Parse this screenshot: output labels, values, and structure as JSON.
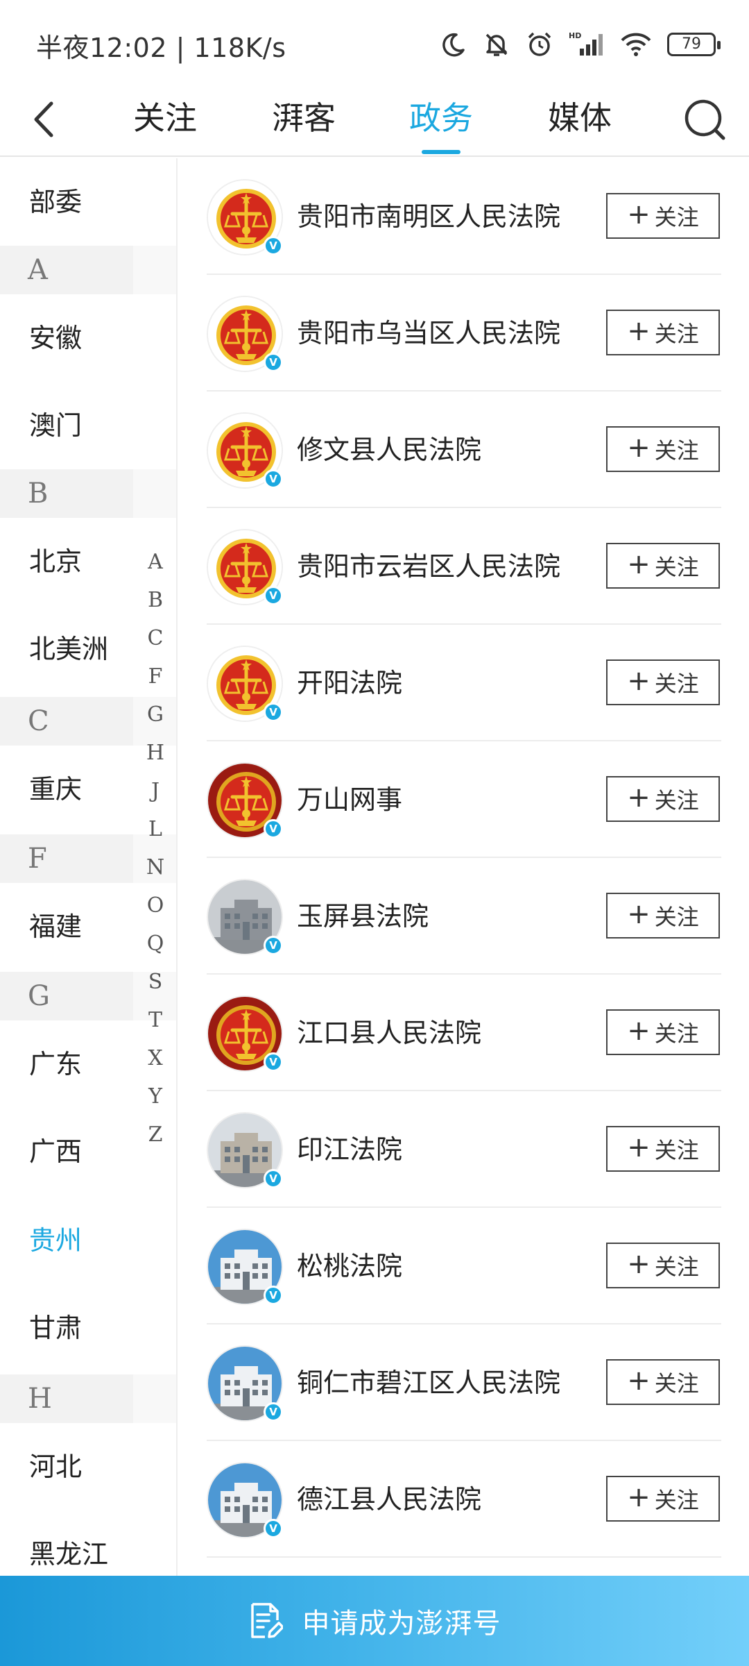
{
  "status_bar": {
    "time_speed": "半夜12:02 | 118K/s",
    "battery": "79",
    "icons": [
      "moon-icon",
      "bell-mute-icon",
      "alarm-icon",
      "signal-icon",
      "wifi-icon",
      "battery-icon"
    ]
  },
  "nav": {
    "back_icon": "chevron-left-icon",
    "tabs": [
      {
        "label": "关注"
      },
      {
        "label": "湃客"
      },
      {
        "label": "政务",
        "active": true
      },
      {
        "label": "媒体"
      }
    ],
    "search_icon": "search-icon"
  },
  "sidebar": {
    "items": [
      {
        "type": "item",
        "label": "部委"
      },
      {
        "type": "letter",
        "label": "A"
      },
      {
        "type": "item",
        "label": "安徽"
      },
      {
        "type": "item",
        "label": "澳门"
      },
      {
        "type": "letter",
        "label": "B"
      },
      {
        "type": "item",
        "label": "北京"
      },
      {
        "type": "item",
        "label": "北美洲"
      },
      {
        "type": "letter",
        "label": "C"
      },
      {
        "type": "item",
        "label": "重庆"
      },
      {
        "type": "letter",
        "label": "F"
      },
      {
        "type": "item",
        "label": "福建"
      },
      {
        "type": "letter",
        "label": "G"
      },
      {
        "type": "item",
        "label": "广东"
      },
      {
        "type": "item",
        "label": "广西"
      },
      {
        "type": "item",
        "label": "贵州",
        "active": true
      },
      {
        "type": "item",
        "label": "甘肃"
      },
      {
        "type": "letter",
        "label": "H"
      },
      {
        "type": "item",
        "label": "河北"
      },
      {
        "type": "item",
        "label": "黑龙江"
      }
    ],
    "alpha_index": [
      "A",
      "B",
      "C",
      "F",
      "G",
      "H",
      "J",
      "L",
      "N",
      "O",
      "Q",
      "S",
      "T",
      "X",
      "Y",
      "Z"
    ]
  },
  "accounts": [
    {
      "name": "贵阳市南明区人民法院",
      "avatar": "court-emblem",
      "verified_badge": "V",
      "follow_label": "关注"
    },
    {
      "name": "贵阳市乌当区人民法院",
      "avatar": "court-emblem",
      "verified_badge": "V",
      "follow_label": "关注"
    },
    {
      "name": "修文县人民法院",
      "avatar": "court-emblem",
      "verified_badge": "V",
      "follow_label": "关注"
    },
    {
      "name": "贵阳市云岩区人民法院",
      "avatar": "court-emblem",
      "verified_badge": "V",
      "follow_label": "关注"
    },
    {
      "name": "开阳法院",
      "avatar": "court-emblem",
      "verified_badge": "V",
      "follow_label": "关注"
    },
    {
      "name": "万山网事",
      "avatar": "court-emblem-dark",
      "verified_badge": "V",
      "follow_label": "关注"
    },
    {
      "name": "玉屏县法院",
      "avatar": "building-gray",
      "verified_badge": "V",
      "follow_label": "关注"
    },
    {
      "name": "江口县人民法院",
      "avatar": "court-emblem-dark",
      "verified_badge": "V",
      "follow_label": "关注"
    },
    {
      "name": "印江法院",
      "avatar": "building-photo",
      "verified_badge": "V",
      "follow_label": "关注"
    },
    {
      "name": "松桃法院",
      "avatar": "building-sky",
      "verified_badge": "V",
      "follow_label": "关注"
    },
    {
      "name": "铜仁市碧江区人民法院",
      "avatar": "building-sky",
      "verified_badge": "V",
      "follow_label": "关注"
    },
    {
      "name": "德江县人民法院",
      "avatar": "building-sky",
      "verified_badge": "V",
      "follow_label": "关注"
    }
  ],
  "bottom_bar": {
    "icon": "document-edit-icon",
    "label": "申请成为澎湃号"
  },
  "colors": {
    "accent": "#1ba8e0",
    "court_red": "#d42a1c",
    "court_gold": "#f2c22e"
  }
}
